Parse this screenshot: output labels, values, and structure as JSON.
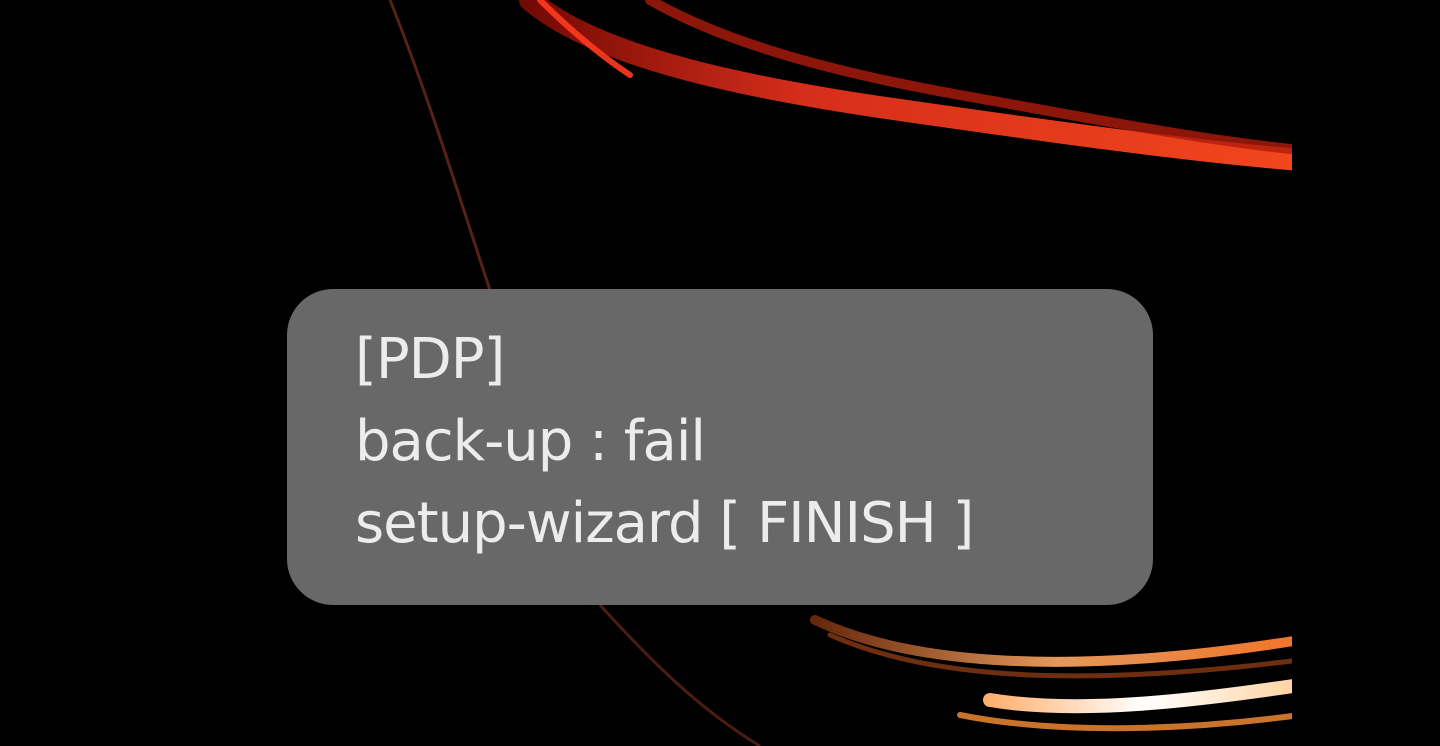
{
  "wallpaper": {
    "background_color": "#000000",
    "accent_colors": [
      "#e0301c",
      "#f0a060",
      "#ffffff"
    ]
  },
  "toast": {
    "background_color": "#6e6e6e",
    "text_color": "#ececec",
    "lines": [
      "[PDP]",
      "back-up : fail",
      "setup-wizard [ FINISH ]"
    ]
  }
}
